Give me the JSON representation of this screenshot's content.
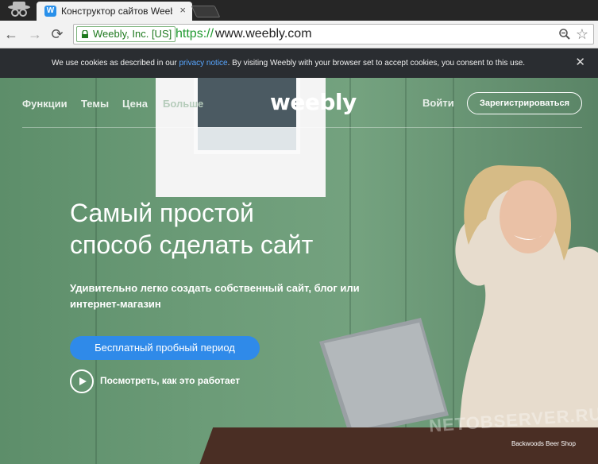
{
  "browser": {
    "tab_title": "Конструктор сайтов Weebly",
    "tab_favicon": "W",
    "tab_close": "×",
    "back_glyph": "←",
    "forward_glyph": "→",
    "reload_glyph": "⟳",
    "ev_label": "Weebly, Inc. [US]",
    "url_scheme": "https://",
    "url_host": "www.weebly.com",
    "star_glyph": "☆",
    "icons": [
      "incognito-icon",
      "weebly-favicon",
      "lock-icon",
      "zoom-icon",
      "star-icon"
    ]
  },
  "cookie_bar": {
    "text_before": "We use cookies as described in our ",
    "link": "privacy notice",
    "text_after": ". By visiting Weebly with your browser set to accept cookies, you consent to this use.",
    "close": "✕"
  },
  "nav": {
    "items": [
      "Функции",
      "Темы",
      "Цена",
      "Больше"
    ],
    "logo": "weebly",
    "login": "Войти",
    "signup": "Зарегистрироваться"
  },
  "hero": {
    "headline_line1": "Самый простой",
    "headline_line2": "способ сделать сайт",
    "subhead": "Удивительно легко создать собственный сайт, блог или интернет-магазин",
    "cta": "Бесплатный пробный период",
    "watch": "Посмотреть, как это работает",
    "watermark": "NETOBSERVER.RU",
    "photo_credit": "Backwoods Beer Shop"
  },
  "colors": {
    "cta": "#2f8ae9",
    "link": "#58a6ff",
    "ev_green": "#1f7a1f"
  }
}
